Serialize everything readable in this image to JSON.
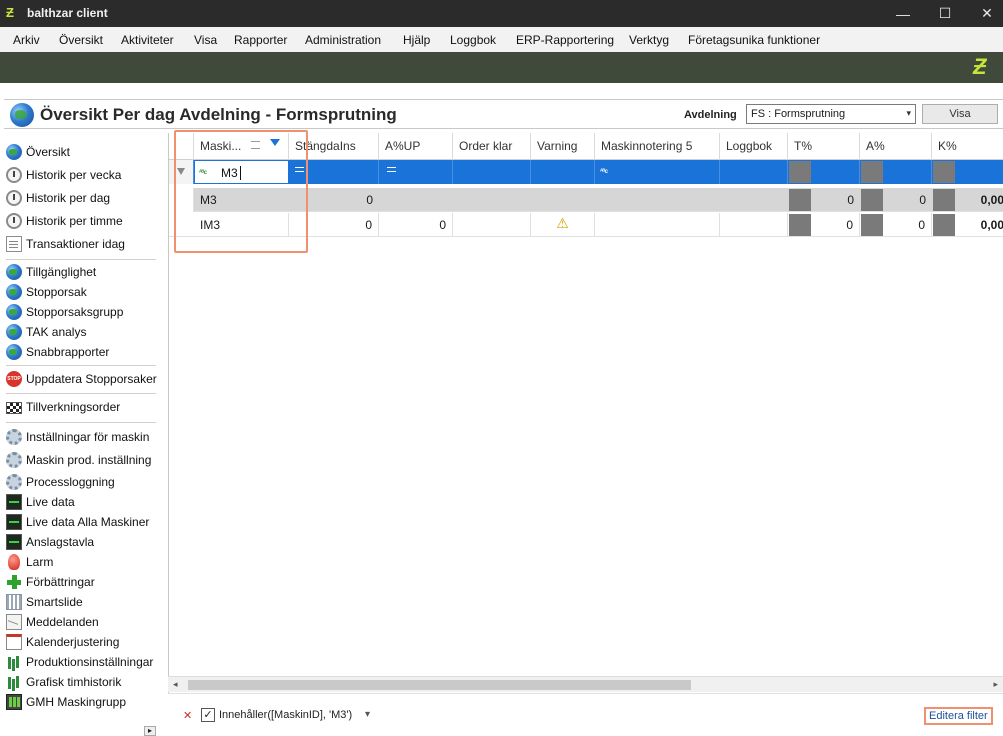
{
  "app": {
    "title": "balthzar client",
    "logo_glyph": "Ƶ",
    "controls": {
      "minimize": "—",
      "maximize": "☐",
      "close": "✕"
    }
  },
  "menu": [
    "Arkiv",
    "Översikt",
    "Aktiviteter",
    "Visa",
    "Rapporter",
    "Administration",
    "Hjälp",
    "Loggbok",
    "ERP-Rapportering",
    "Verktyg",
    "Företagsunika funktioner"
  ],
  "header": {
    "page_title": "Översikt Per dag Avdelning - Formsprutning",
    "avdelning_label": "Avdelning",
    "avdelning_value": "FS : Formsprutning",
    "visa_label": "Visa"
  },
  "sidebar": {
    "items": [
      {
        "label": "Översikt",
        "icon": "globe-icon"
      },
      {
        "label": "Historik per vecka",
        "icon": "clock-icon"
      },
      {
        "label": "Historik per dag",
        "icon": "clock-icon"
      },
      {
        "label": "Historik per timme",
        "icon": "clock-person-icon"
      },
      {
        "label": "Transaktioner idag",
        "icon": "document-icon"
      },
      {
        "label": "Tillgänglighet",
        "icon": "globe-icon"
      },
      {
        "label": "Stopporsak",
        "icon": "globe-icon"
      },
      {
        "label": "Stopporsaksgrupp",
        "icon": "globe-icon"
      },
      {
        "label": "TAK analys",
        "icon": "globe-icon"
      },
      {
        "label": "Snabbrapporter",
        "icon": "globe-icon"
      },
      {
        "label": "Uppdatera Stopporsaker",
        "icon": "stop-sign-icon"
      },
      {
        "label": "Tillverkningsorder",
        "icon": "checkered-flag-icon"
      },
      {
        "label": "Inställningar för maskin",
        "icon": "gear-icon"
      },
      {
        "label": "Maskin prod. inställning",
        "icon": "gear-icon"
      },
      {
        "label": "Processloggning",
        "icon": "gear-icon"
      },
      {
        "label": "Live data",
        "icon": "monitor-icon"
      },
      {
        "label": "Live data Alla Maskiner",
        "icon": "monitor-icon"
      },
      {
        "label": "Anslagstavla",
        "icon": "monitor-icon"
      },
      {
        "label": "Larm",
        "icon": "bulb-icon"
      },
      {
        "label": "Förbättringar",
        "icon": "plus-icon"
      },
      {
        "label": "Smartslide",
        "icon": "grid-icon"
      },
      {
        "label": "Meddelanden",
        "icon": "envelope-icon"
      },
      {
        "label": "Kalenderjustering",
        "icon": "calendar-icon"
      },
      {
        "label": "Produktionsinställningar",
        "icon": "bar-chart-icon"
      },
      {
        "label": "Grafisk timhistorik",
        "icon": "bar-chart-icon"
      },
      {
        "label": "GMH Maskingrupp",
        "icon": "gmh-icon"
      }
    ],
    "stop_icon_text": "STOP"
  },
  "grid": {
    "columns": [
      "Maski...",
      "StängdaIns",
      "A%UP",
      "Order klar",
      "Varning",
      "Maskinnotering 5",
      "Loggbok",
      "T%",
      "A%",
      "K%"
    ],
    "filter_value": "M3",
    "abc_glyph": "ᴬᴮc",
    "rows": [
      {
        "maskin": "M3",
        "stangda": "0",
        "aup": "",
        "varning": "",
        "t": "0",
        "a": "0",
        "k": "0,00"
      },
      {
        "maskin": "IM3",
        "stangda": "0",
        "aup": "0",
        "varning": "⚠",
        "t": "0",
        "a": "0",
        "k": "0,00"
      }
    ]
  },
  "footer": {
    "filter_expression": "Innehåller([MaskinID], 'M3')",
    "edit_filter_label": "Editera filter",
    "clear_glyph": "✕",
    "check_glyph": "✓",
    "dropdown_glyph": "▾"
  },
  "colors": {
    "selection_blue": "#1a73d8",
    "highlight_orange": "#f0906f",
    "band_green": "#3f4a3b",
    "logo_lime": "#c6e33a"
  }
}
